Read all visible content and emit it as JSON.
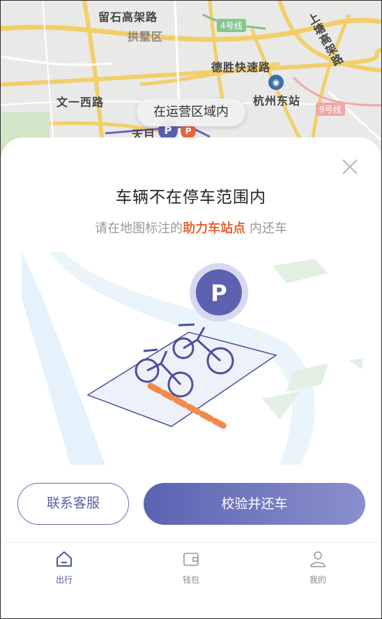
{
  "map": {
    "labels": {
      "liushi": "留石高架路",
      "gongshu": "拱墅区",
      "line4": "4号线",
      "desheng": "德胜快速路",
      "shangtang": "上塘高架路",
      "wenyi": "文一西路",
      "hangzhoudong": "杭州东站",
      "line9": "9号线",
      "tianmu": "天目"
    },
    "in_zone_label": "在运营区域内",
    "p_marker": "P"
  },
  "sheet": {
    "title": "车辆不在停车范围内",
    "subtitle_prefix": "请在地图标注的",
    "subtitle_highlight": "助力车站点",
    "subtitle_suffix": " 内还车",
    "illustration_p": "P",
    "buttons": {
      "contact": "联系客服",
      "verify_return": "校验并还车"
    }
  },
  "tabbar": {
    "items": [
      {
        "label": "出行",
        "icon": "home-icon",
        "active": true
      },
      {
        "label": "钱包",
        "icon": "wallet-icon",
        "active": false
      },
      {
        "label": "我的",
        "icon": "user-icon",
        "active": false
      }
    ]
  },
  "colors": {
    "accent": "#5c62b0",
    "highlight": "#e8643a"
  }
}
